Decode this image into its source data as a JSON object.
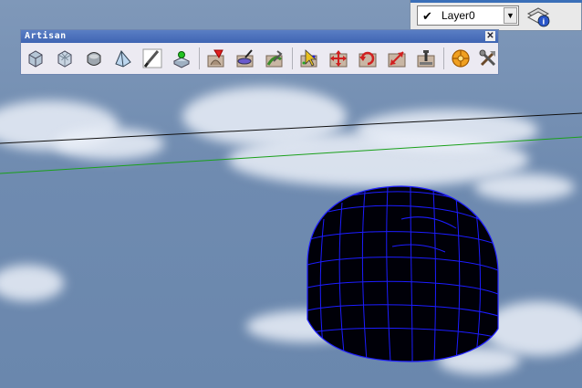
{
  "layer_toolbar": {
    "current_layer": "Layer0",
    "dropdown_arrow": "▼"
  },
  "artisan_toolbar": {
    "title": "Artisan",
    "close_glyph": "✕",
    "tools": [
      {
        "name": "subdivide-smooth-icon"
      },
      {
        "name": "subdivide-icon"
      },
      {
        "name": "smooth-icon"
      },
      {
        "name": "crease-icon"
      },
      {
        "name": "knife-subdivide-icon"
      },
      {
        "name": "tag-vertices-icon"
      },
      {
        "name": "sculpt-brush-icon"
      },
      {
        "name": "flatten-brush-icon"
      },
      {
        "name": "pinch-brush-icon"
      },
      {
        "name": "select-vertices-icon"
      },
      {
        "name": "move-vertices-icon"
      },
      {
        "name": "rotate-vertices-icon"
      },
      {
        "name": "scale-vertices-icon"
      },
      {
        "name": "flatten-vertices-icon"
      },
      {
        "name": "organizer-icon"
      },
      {
        "name": "settings-tools-icon"
      }
    ]
  }
}
